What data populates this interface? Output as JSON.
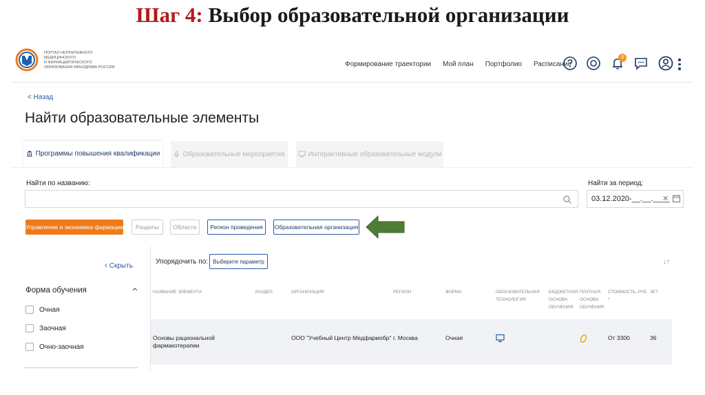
{
  "slide": {
    "step": "Шаг 4:",
    "title": "Выбор образовательной организации"
  },
  "header": {
    "logo_lines": [
      "Портал непрерывного",
      "медицинского",
      "и фармацевтического",
      "образования Минздрава России"
    ],
    "nav": [
      "Формирование траектории",
      "Мой план",
      "Портфолио",
      "Расписание"
    ],
    "notification_count": "3",
    "icons": [
      "help-icon",
      "location-icon",
      "bell-icon",
      "chat-icon",
      "user-icon",
      "more-icon"
    ]
  },
  "back_link": "< Назад",
  "page_title": "Найти образовательные элементы",
  "tabs": [
    {
      "label": "Программы повышения квалификации",
      "icon": "bank-icon",
      "active": true
    },
    {
      "label": "Образовательные мероприятия",
      "icon": "mic-icon",
      "active": false
    },
    {
      "label": "Интерактивные образовательные модули",
      "icon": "monitor-icon",
      "active": false
    }
  ],
  "search": {
    "label": "Найти по названию:",
    "value": "",
    "placeholder": ""
  },
  "period": {
    "label": "Найти за период:",
    "value": "03.12.2020-__.__.____"
  },
  "filters": [
    {
      "label": "Управление и экономика фармации",
      "style": "orange"
    },
    {
      "label": "Разделы",
      "style": "gray"
    },
    {
      "label": "Области",
      "style": "gray"
    },
    {
      "label": "Регион проведения",
      "style": "blue"
    },
    {
      "label": "Образовательная организация",
      "style": "blue"
    }
  ],
  "sidebar": {
    "hide": "Скрыть",
    "form_title": "Форма обучения",
    "options": [
      "Очная",
      "Заочная",
      "Очно-заочная"
    ]
  },
  "sort": {
    "label": "Упорядочить по:",
    "button": "Выберите параметр"
  },
  "table": {
    "columns": {
      "name": "Название элемента",
      "section": "Раздел",
      "org": "Организация",
      "region": "Регион",
      "form": "Форма",
      "tech": [
        "Образовательная",
        "технология"
      ],
      "budget": [
        "Бюджетная",
        "основа",
        "обучения"
      ],
      "paid": [
        "Платная",
        "основа",
        "обучения"
      ],
      "cost": [
        "Стоимость, руб",
        "*"
      ],
      "zet": "ЗЕТ"
    },
    "rows": [
      {
        "name": [
          "Основы рациональной",
          "фармакотерапии"
        ],
        "section": "",
        "org": "ООО \"Учебный Центр Медфармобр\"",
        "region": "г. Москва",
        "form": "Очная",
        "cost": "От 3300",
        "zet": "36"
      }
    ]
  },
  "colors": {
    "accent_blue": "#1e3a66",
    "link_blue": "#2a5aa6",
    "orange": "#f07a1a",
    "arrow_green": "#4e7d36",
    "step_red": "#b31b1b"
  }
}
